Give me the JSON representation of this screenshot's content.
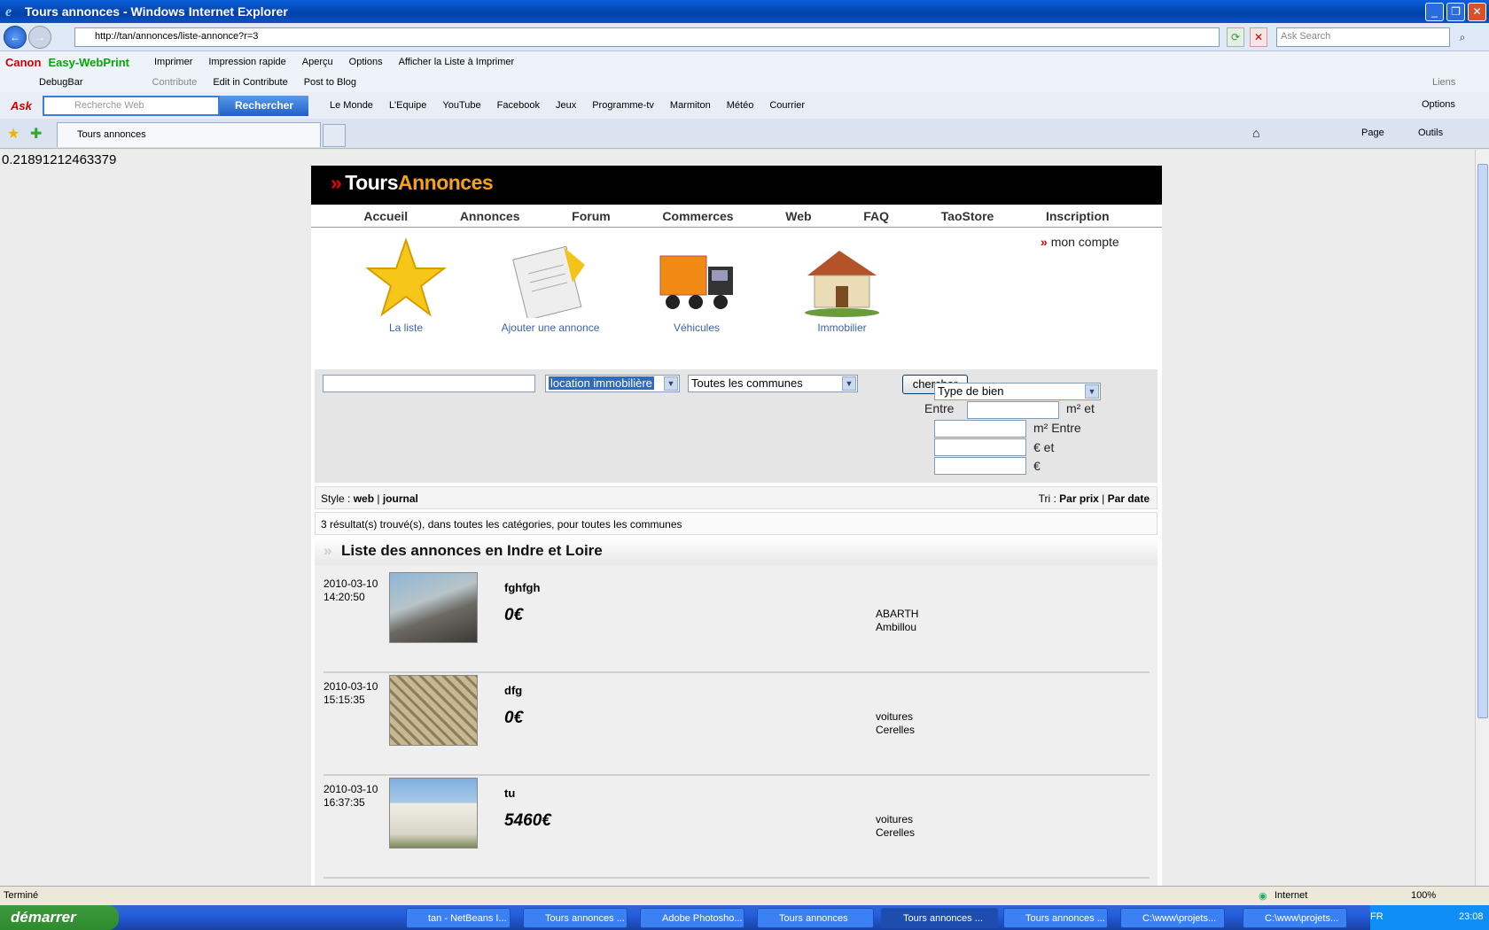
{
  "window": {
    "title": "Tours annonces - Windows Internet Explorer"
  },
  "addressbar": {
    "url": "http://tan/annonces/liste-annonce?r=3",
    "search_placeholder": "Ask Search"
  },
  "toolbar1": {
    "brand": "Canon",
    "app": "Easy-WebPrint",
    "items": [
      "Imprimer",
      "Impression rapide",
      "Aperçu",
      "Options",
      "Afficher la Liste à Imprimer"
    ]
  },
  "toolbar2": {
    "items": [
      "DebugBar",
      "Contribute",
      "Edit in Contribute",
      "Post to Blog"
    ],
    "links": "Liens"
  },
  "toolbar3": {
    "ask_placeholder": "Recherche Web",
    "ask_button": "Rechercher",
    "links": [
      "Le Monde",
      "L'Equipe",
      "YouTube",
      "Facebook",
      "Jeux",
      "Programme-tv",
      "Marmiton",
      "Météo",
      "Courrier"
    ],
    "options": "Options"
  },
  "tabs": {
    "active": "Tours annonces",
    "page_menu": "Page",
    "tools_menu": "Outils"
  },
  "debug_value": "0.21891212463379",
  "site": {
    "logo_a": "Tours",
    "logo_b": "Annonces",
    "nav": [
      "Accueil",
      "Annonces",
      "Forum",
      "Commerces",
      "Web",
      "FAQ",
      "TaoStore",
      "Inscription"
    ],
    "compte": "mon compte",
    "categories": [
      "La liste",
      "Ajouter une annonce",
      "Véhicules",
      "Immobilier"
    ],
    "filters": {
      "keyword": "",
      "category": "location immobilière",
      "commune": "Toutes les communes",
      "button": "chercher",
      "type": "Type de bien",
      "entre": "Entre",
      "m2_et": "m² et",
      "m2_entre": "m²  Entre",
      "eur_et": "€ et",
      "eur": "€"
    },
    "style_label": "Style : ",
    "style_web": "web",
    "style_journal": "journal",
    "tri_label": "Tri : ",
    "tri_prix": "Par prix",
    "tri_date": "Par date",
    "results": "3 résultat(s) trouvé(s), dans toutes les catégories, pour toutes les communes",
    "list_title": "Liste des annonces en Indre et Loire",
    "items": [
      {
        "date": "2010-03-10",
        "time": "14:20:50",
        "title": "fghfgh",
        "price": "0€",
        "brand": "ABARTH",
        "city": "Ambillou"
      },
      {
        "date": "2010-03-10",
        "time": "15:15:35",
        "title": "dfg",
        "price": "0€",
        "brand": "voitures",
        "city": "Cerelles"
      },
      {
        "date": "2010-03-10",
        "time": "16:37:35",
        "title": "tu",
        "price": "5460€",
        "brand": "voitures",
        "city": "Cerelles"
      }
    ]
  },
  "status": {
    "text": "Terminé",
    "zone": "Internet",
    "zoom": "100%"
  },
  "taskbar": {
    "start": "démarrer",
    "tasks": [
      "tan - NetBeans I...",
      "Tours annonces ...",
      "Adobe Photosho...",
      "Tours annonces",
      "Tours annonces ...",
      "Tours annonces ...",
      "C:\\www\\projets...",
      "C:\\www\\projets..."
    ],
    "lang": "FR",
    "clock": "23:08"
  }
}
